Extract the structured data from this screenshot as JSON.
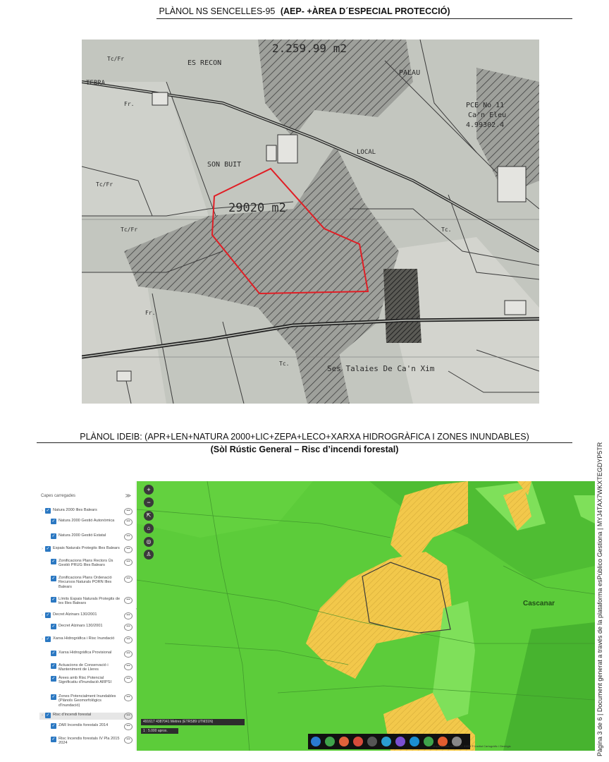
{
  "title1_plain": "PLÀNOL NS SENCELLES-95",
  "title1_bold": "(AEP- +ÀREA D´ESPECIAL PROTECCIÓ)",
  "map1": {
    "area_top": "2.259.99 m2",
    "area_main": "29020 m2",
    "labels": {
      "es_recon": "ES RECON",
      "son_buit": "SON BUIT",
      "palau": "PALAU",
      "local": "LOCAL",
      "tebra": "TEBRA",
      "pce": "PCE No 11",
      "caneleu": "Ca'n Eleu",
      "number": "4.99302.4",
      "talaies": "Ses Talaies De Ca'n Xim"
    },
    "parcel_codes": [
      "Tc/Fr",
      "Fr.",
      "Tc/Fr",
      "Tc.",
      "Fr.",
      "Tc/Fr",
      "Tc."
    ]
  },
  "title2": "PLÀNOL IDEIB: (APR+LEN+NATURA 2000+LIC+ZEPA+LECO+XARXA HIDROGRÀFICA I ZONES INUNDABLES)",
  "title3": "(Sòl Rústic General – Risc d’incendi forestal)",
  "layers_panel": {
    "heading": "Capes carregades",
    "items": [
      "Natura 2000 Illes Balears",
      "Natura 2000 Gestió Autonòmica",
      "Natura 2000 Gestió Estatal",
      "Espais Naturals Protegits Illes Balears",
      "Zonificacions Plans Rectors Ús Gestió PRUG Illes Balears",
      "Zonificacions Plans Ordenació Recursos Naturals PORN Illes Balears",
      "Límits Espais Naturals Protegits de les Illes Balears",
      "Decret Alzinars 130/2001",
      "Decret Alzinars 130/2001",
      "Xarxa Hidrogràfica i Risc Inundació",
      "Xarxa Hidrogràfica Provisional",
      "Actuacions de Conservació i Manteniment de Lleres",
      "Àrees amb Risc Potencial Significatiu d'Inundació ARPSI",
      "Zones Potencialment Inundables (Plànols Geomorfològics d'Inundació)",
      "Risc d'incendi forestal",
      "ZAR Incendis forestals 2014",
      "Risc Incendis forestals IV Pla 2015 2024"
    ]
  },
  "gmap": {
    "place": "Cascanar",
    "coord": "491617 4387041 Metres (ETRS89 UTM31N)",
    "scale": "1 : 5.000 aprox.",
    "attribution": "Mapa de Illes Balears © IDEIB © Institut Cartogràfic i Geològic"
  },
  "side_caption": "Pàgina 3 de 6 | Document generat a través de la plataforma esPúblico Gestiona | MYJ4TAX7WKXTEGDYP5TR"
}
